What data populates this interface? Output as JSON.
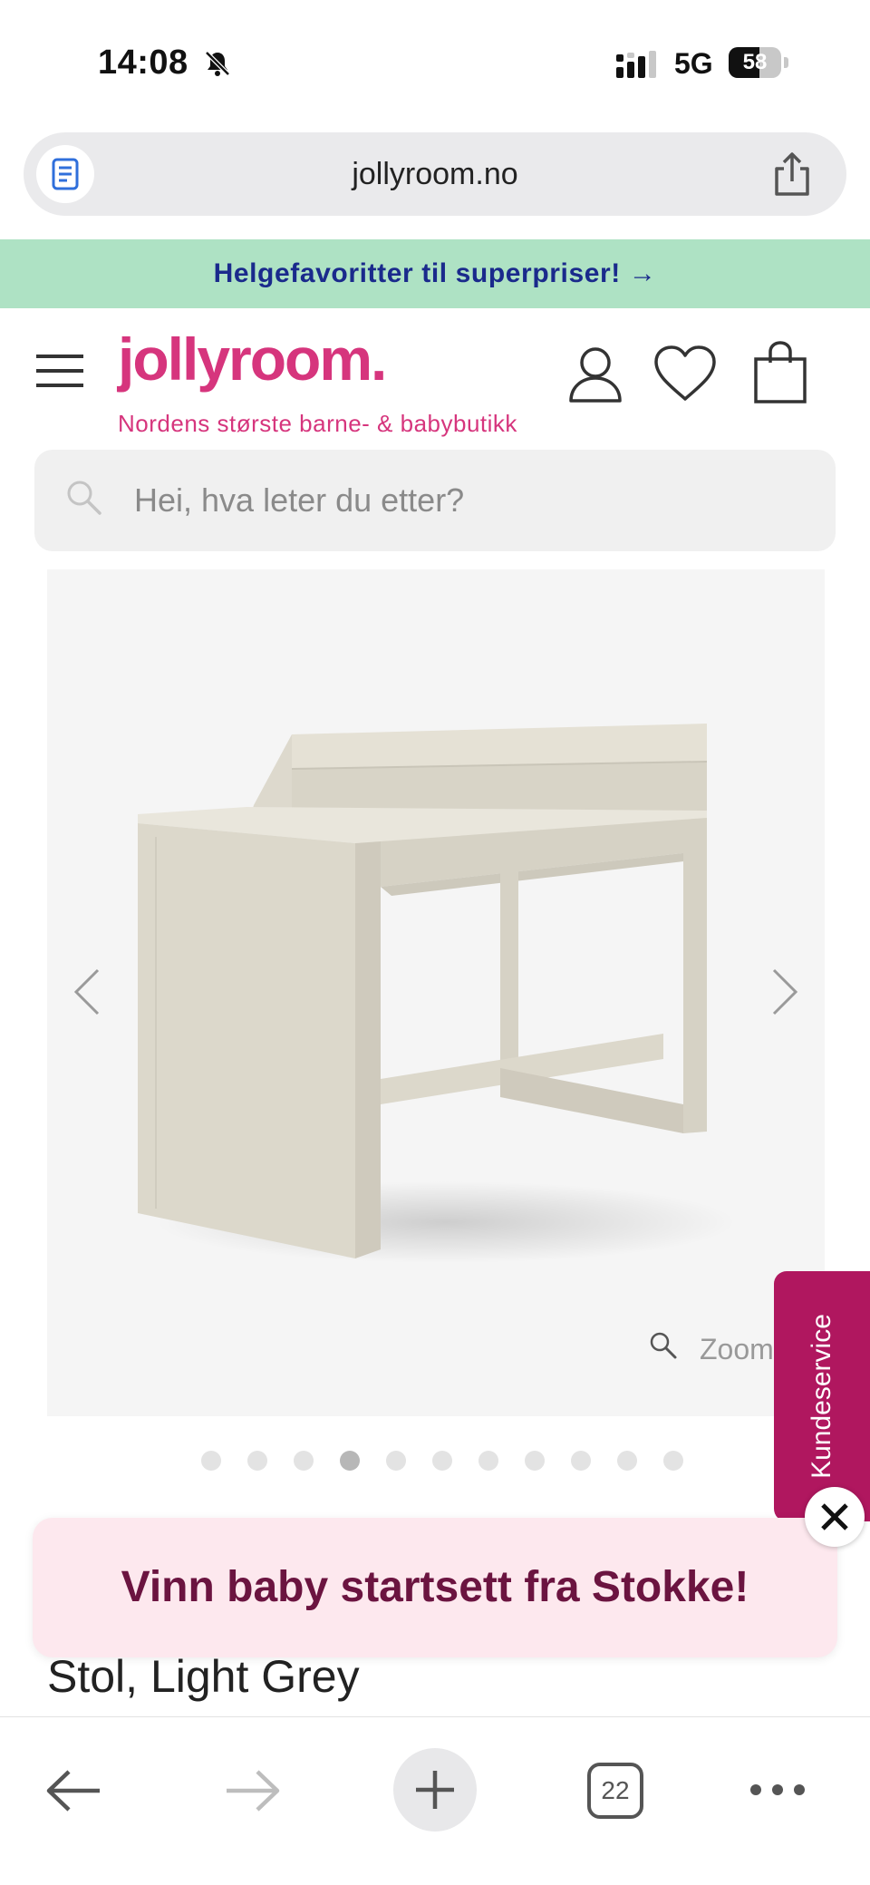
{
  "status_bar": {
    "time": "14:08",
    "network": "5G",
    "battery_level": "58",
    "battery_fraction": 0.58
  },
  "browser": {
    "url": "jollyroom.no",
    "tab_count": "22"
  },
  "promo_banner": {
    "text": "Helgefavoritter til superpriser! →"
  },
  "header": {
    "logo": "jollyroom.",
    "tagline": "Nordens største barne- & babybutikk"
  },
  "search": {
    "placeholder": "Hei, hva leter du etter?"
  },
  "gallery": {
    "zoom_label": "Zoom",
    "dot_count": 11,
    "active_dot_index": 3
  },
  "side_tab": {
    "label": "Kundeservice"
  },
  "popup": {
    "text": "Vinn baby startsett fra Stokke!"
  },
  "product": {
    "title_visible": "Stol, Light Grey"
  },
  "colors": {
    "brand_pink": "#d6357d",
    "promo_green": "#aee2c4",
    "promo_text": "#1a2a8c",
    "side_tab": "#b0175f",
    "popup_bg": "#fde8ee",
    "popup_text": "#6b1440"
  },
  "icons": [
    "bell-slash-icon",
    "signal-icon",
    "battery-icon",
    "reader-icon",
    "share-icon",
    "menu-icon",
    "account-icon",
    "heart-icon",
    "cart-icon",
    "search-icon",
    "chevron-left-icon",
    "chevron-right-icon",
    "zoom-icon",
    "close-icon",
    "back-icon",
    "forward-icon",
    "plus-icon",
    "more-icon"
  ]
}
